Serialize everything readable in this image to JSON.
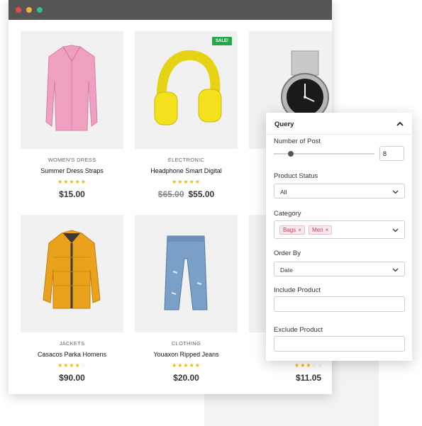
{
  "products": [
    {
      "category": "WOMEN'S DRESS",
      "name": "Summer Dress Straps",
      "rating": 5,
      "old_price": "",
      "price": "$15.00",
      "sale_badge": ""
    },
    {
      "category": "ELECTRONIC",
      "name": "Headphone Smart Digital",
      "rating": 5,
      "old_price": "$65.00",
      "price": "$55.00",
      "sale_badge": "SALE!"
    },
    {
      "category": "",
      "name": "",
      "rating": 0,
      "old_price": "",
      "price": "",
      "sale_badge": ""
    },
    {
      "category": "JACKETS",
      "name": "Casacos Parka Homens",
      "rating": 4,
      "old_price": "",
      "price": "$90.00",
      "sale_badge": ""
    },
    {
      "category": "CLOTHING",
      "name": "Youaxon Ripped Jeans",
      "rating": 5,
      "old_price": "",
      "price": "$20.00",
      "sale_badge": ""
    },
    {
      "category": "",
      "name": "",
      "rating": 3,
      "old_price": "",
      "price": "$11.05",
      "sale_badge": ""
    }
  ],
  "panel": {
    "title": "Query",
    "number_of_post_label": "Number of Post",
    "number_of_post_value": "8",
    "product_status_label": "Product Status",
    "product_status_value": "All",
    "category_label": "Category",
    "category_tags": [
      "Bags",
      "Men"
    ],
    "order_by_label": "Order By",
    "order_by_value": "Date",
    "include_product_label": "Include Product",
    "exclude_product_label": "Exclude Product"
  },
  "colors": {
    "star": "#f5b400",
    "sale_badge": "#22a84a",
    "tag_text": "#d33b5c",
    "titlebar": "#555555"
  },
  "icons": [
    "close-dot-icon",
    "minimize-dot-icon",
    "maximize-dot-icon",
    "chevron-up-icon",
    "chevron-down-icon",
    "star-icon"
  ]
}
